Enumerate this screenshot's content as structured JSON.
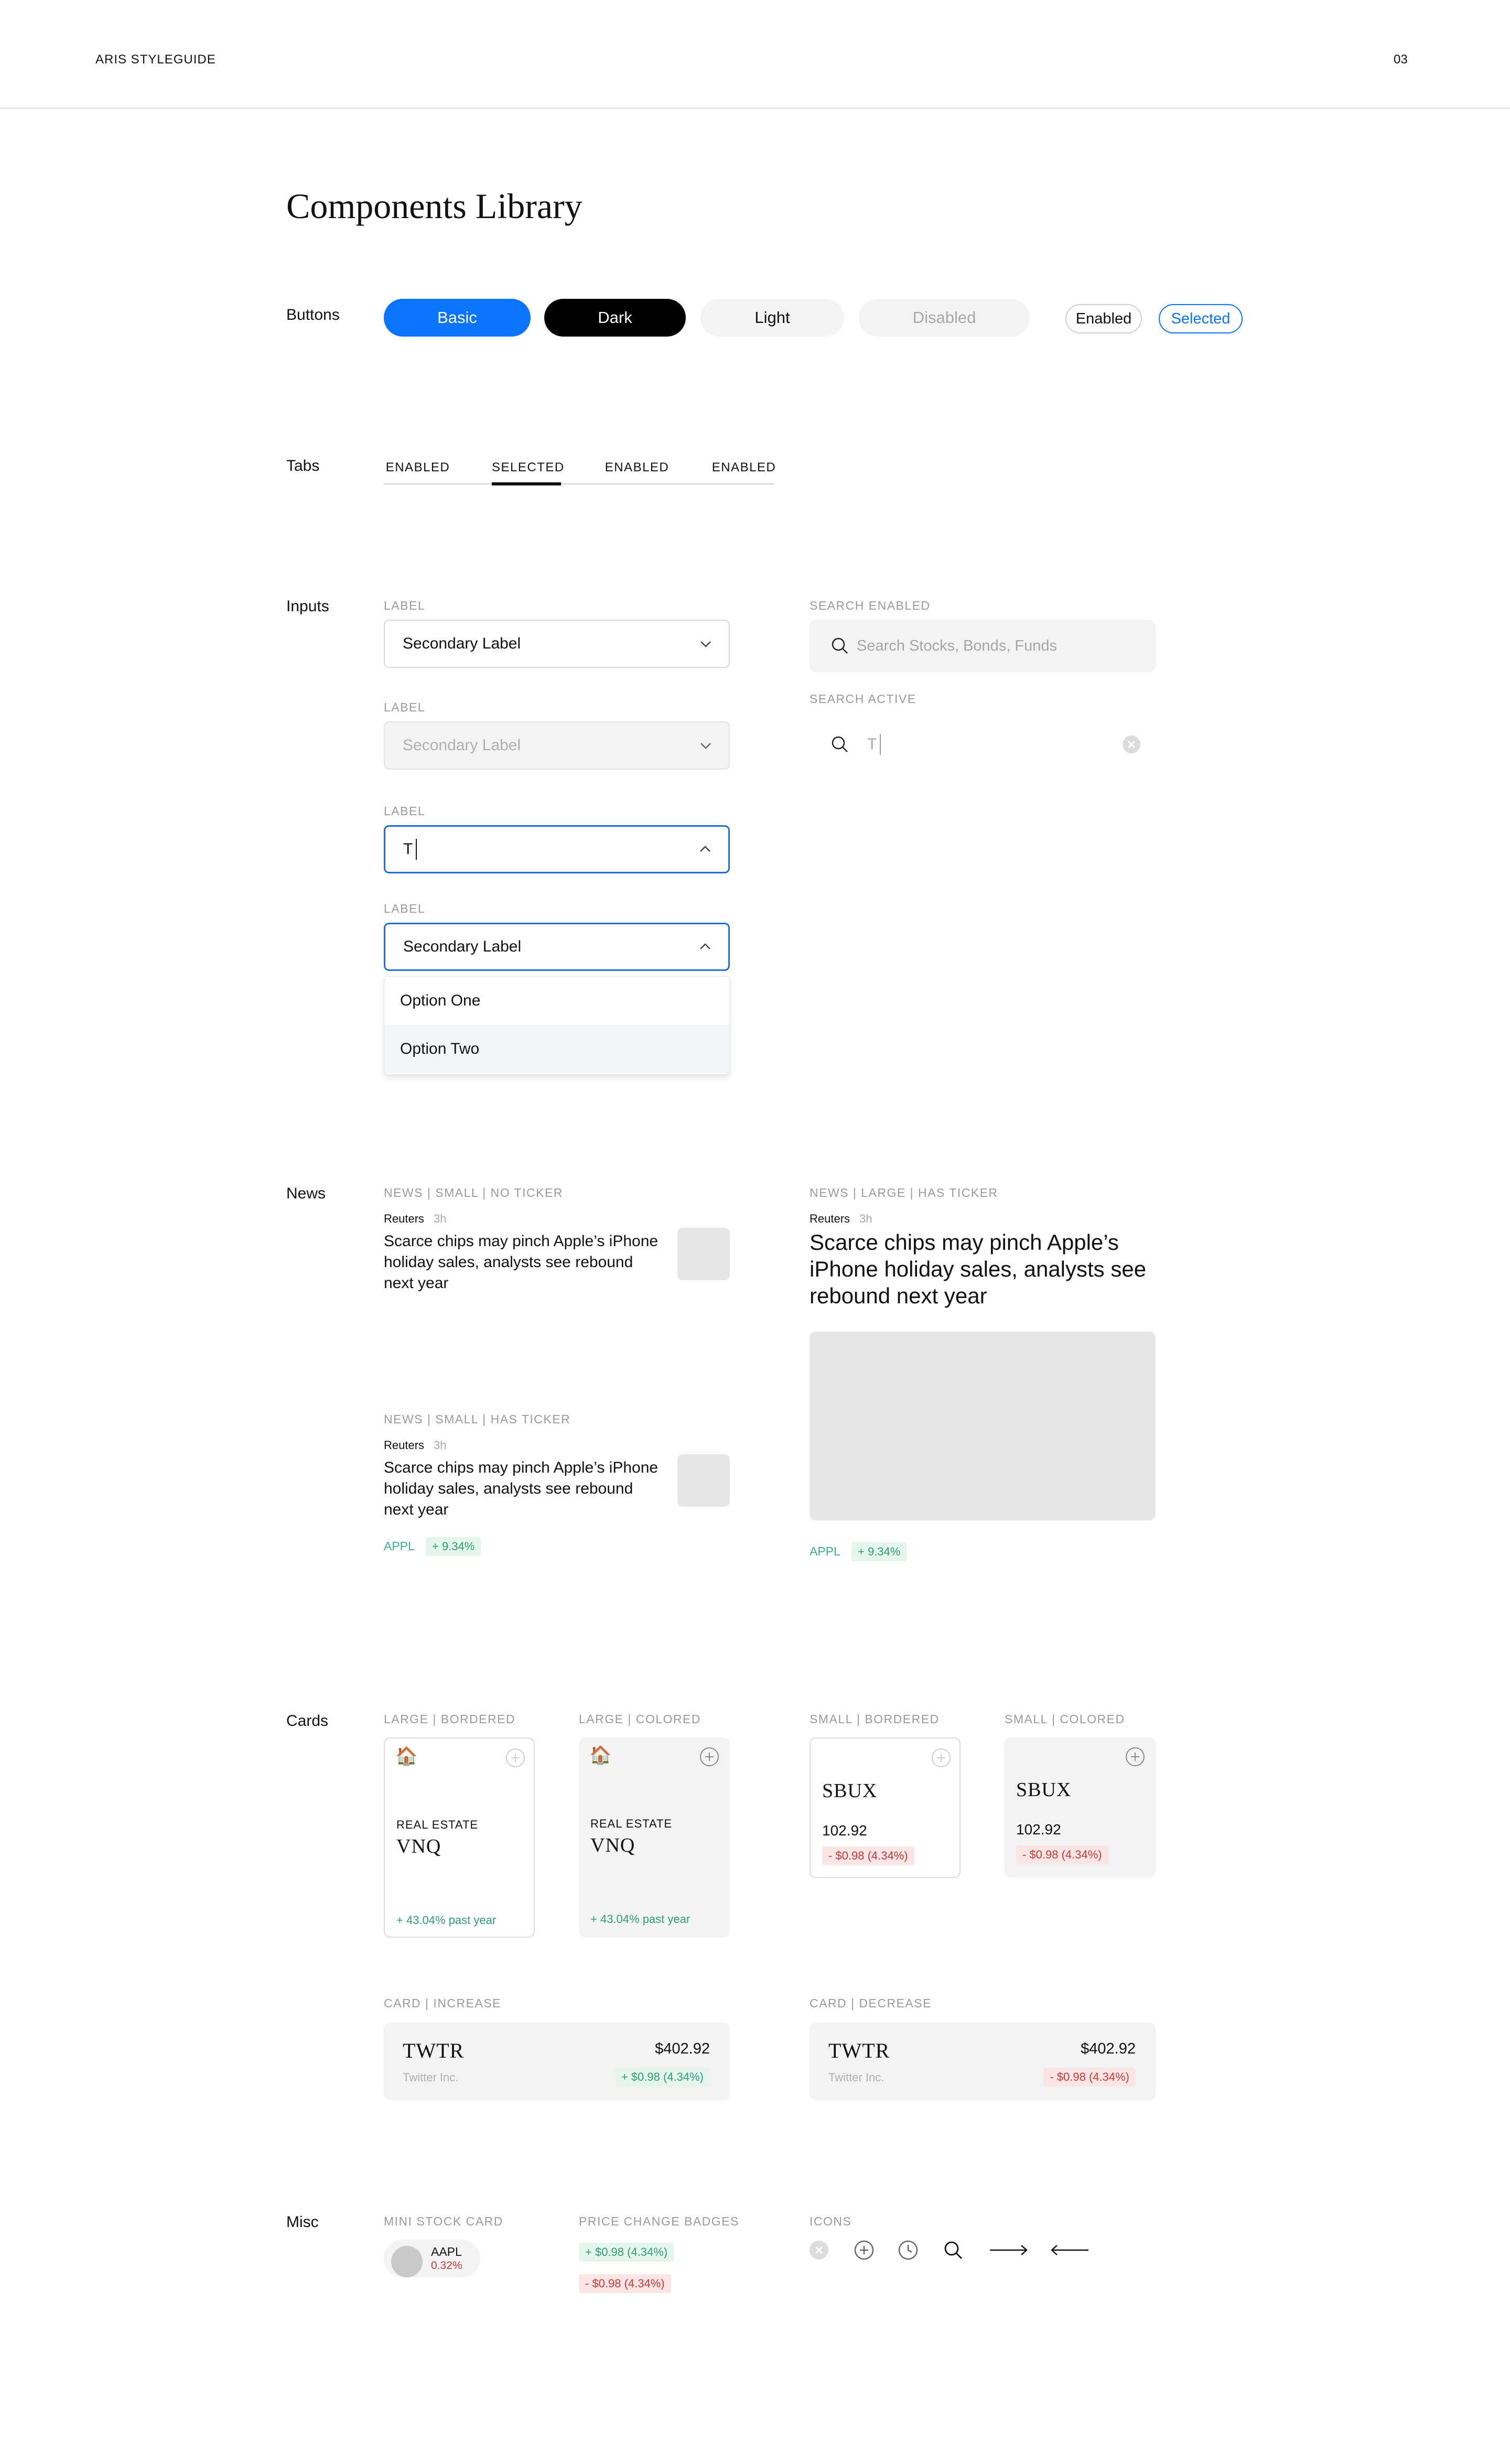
{
  "header": {
    "brand": "ARIS STYLEGUIDE",
    "page_number": "03"
  },
  "page_title": "Components Library",
  "sections": {
    "buttons": "Buttons",
    "tabs": "Tabs",
    "inputs": "Inputs",
    "news": "News",
    "cards": "Cards",
    "misc": "Misc"
  },
  "buttons": {
    "basic": "Basic",
    "dark": "Dark",
    "light": "Light",
    "disabled": "Disabled",
    "chip_enabled": "Enabled",
    "chip_selected": "Selected"
  },
  "tabs": {
    "items": [
      {
        "label": "ENABLED"
      },
      {
        "label": "SELECTED"
      },
      {
        "label": "ENABLED"
      },
      {
        "label": "ENABLED"
      }
    ],
    "selected_index": 1
  },
  "inputs": {
    "select_default": {
      "label": "LABEL",
      "value": "Secondary Label"
    },
    "select_disabled": {
      "label": "LABEL",
      "value": "Secondary Label"
    },
    "text_active": {
      "label": "LABEL",
      "value": "T"
    },
    "select_open": {
      "label": "LABEL",
      "value": "Secondary Label",
      "options": [
        "Option One",
        "Option Two"
      ]
    },
    "search_enabled": {
      "label": "SEARCH ENABLED",
      "placeholder": "Search Stocks, Bonds, Funds"
    },
    "search_active": {
      "label": "SEARCH ACTIVE",
      "value": "T"
    }
  },
  "news": {
    "small_no_ticker": {
      "label": "NEWS | SMALL | NO TICKER",
      "source": "Reuters",
      "time": "3h",
      "title": "Scarce chips may pinch Apple’s iPhone holiday sales, analysts see rebound next year"
    },
    "small_has_ticker": {
      "label": "NEWS | SMALL | HAS TICKER",
      "source": "Reuters",
      "time": "3h",
      "title": "Scarce chips may pinch Apple’s iPhone holiday sales, analysts see rebound next year",
      "ticker": "APPL",
      "change": "+ 9.34%"
    },
    "large_has_ticker": {
      "label": "NEWS | LARGE | HAS TICKER",
      "source": "Reuters",
      "time": "3h",
      "title": "Scarce chips may pinch Apple’s iPhone holiday sales, analysts see rebound next year",
      "ticker": "APPL",
      "change": "+ 9.34%"
    }
  },
  "cards": {
    "large_bordered": {
      "label": "LARGE | BORDERED",
      "icon": "house-icon",
      "category": "REAL ESTATE",
      "ticker": "VNQ",
      "gain": "+ 43.04% past year"
    },
    "large_colored": {
      "label": "LARGE | COLORED",
      "icon": "house-icon",
      "category": "REAL ESTATE",
      "ticker": "VNQ",
      "gain": "+ 43.04% past year"
    },
    "small_bordered": {
      "label": "SMALL | BORDERED",
      "ticker": "SBUX",
      "price": "102.92",
      "change": "- $0.98 (4.34%)"
    },
    "small_colored": {
      "label": "SMALL | COLORED",
      "ticker": "SBUX",
      "price": "102.92",
      "change": "- $0.98 (4.34%)"
    },
    "increase": {
      "label": "CARD | INCREASE",
      "ticker": "TWTR",
      "company": "Twitter Inc.",
      "price": "$402.92",
      "change": "+ $0.98 (4.34%)"
    },
    "decrease": {
      "label": "CARD | DECREASE",
      "ticker": "TWTR",
      "company": "Twitter Inc.",
      "price": "$402.92",
      "change": "- $0.98 (4.34%)"
    }
  },
  "misc": {
    "mini_label": "MINI STOCK CARD",
    "mini_symbol": "AAPL",
    "mini_change": "0.32%",
    "badges_label": "PRICE CHANGE BADGES",
    "badge_up": "+ $0.98 (4.34%)",
    "badge_down": "- $0.98 (4.34%)",
    "icons_label": "ICONS",
    "icons": [
      "close-circle-icon",
      "plus-circle-icon",
      "clock-icon",
      "search-icon",
      "arrow-right-icon",
      "arrow-left-icon"
    ]
  },
  "colors": {
    "primary": "#0a74ff",
    "dark": "#000000",
    "light_bg": "#f3f3f3",
    "positive": "#2e9e76",
    "positive_bg": "#e4f6ee",
    "negative": "#c83a3a",
    "negative_bg": "#fbe5e5",
    "focus_border": "#1f6fd6"
  }
}
